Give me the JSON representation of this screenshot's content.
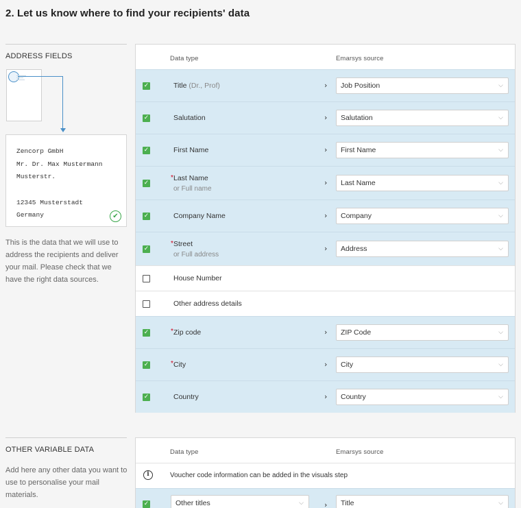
{
  "heading": "2. Let us know where to find your recipients' data",
  "address_section": {
    "label": "ADDRESS FIELDS",
    "card_lines": [
      "Zencorp GmbH",
      "Mr. Dr. Max Mustermann",
      "Musterstr.",
      "",
      "12345 Musterstadt",
      "Germany"
    ],
    "description": "This is the data that we will use to address the recipients and deliver your mail. Please check that we have the right data sources.",
    "col_data_type": "Data type",
    "col_source": "Emarsys source",
    "rows": [
      {
        "label": "Title",
        "hint": "(Dr., Prof)",
        "sub": "",
        "required": false,
        "checked": true,
        "source": "Job Position"
      },
      {
        "label": "Salutation",
        "hint": "",
        "sub": "",
        "required": false,
        "checked": true,
        "source": "Salutation"
      },
      {
        "label": "First Name",
        "hint": "",
        "sub": "",
        "required": false,
        "checked": true,
        "source": "First Name"
      },
      {
        "label": "Last Name",
        "hint": "",
        "sub": "or Full name",
        "required": true,
        "checked": true,
        "source": "Last Name"
      },
      {
        "label": "Company Name",
        "hint": "",
        "sub": "",
        "required": false,
        "checked": true,
        "source": "Company"
      },
      {
        "label": "Street",
        "hint": "",
        "sub": "or Full address",
        "required": true,
        "checked": true,
        "source": "Address"
      },
      {
        "label": "House Number",
        "hint": "",
        "sub": "",
        "required": false,
        "checked": false,
        "source": ""
      },
      {
        "label": "Other address details",
        "hint": "",
        "sub": "",
        "required": false,
        "checked": false,
        "source": ""
      },
      {
        "label": "Zip code",
        "hint": "",
        "sub": "",
        "required": true,
        "checked": true,
        "source": "ZIP Code"
      },
      {
        "label": "City",
        "hint": "",
        "sub": "",
        "required": true,
        "checked": true,
        "source": "City"
      },
      {
        "label": "Country",
        "hint": "",
        "sub": "",
        "required": false,
        "checked": true,
        "source": "Country"
      }
    ]
  },
  "other_section": {
    "label": "OTHER VARIABLE DATA",
    "description": "Add here any other data you want to use to personalise your mail materials.",
    "col_data_type": "Data type",
    "col_source": "Emarsys source",
    "info_text": "Voucher code information can be added in the visuals step",
    "row": {
      "checked": true,
      "type_value": "Other titles",
      "source": "Title"
    }
  },
  "colors": {
    "row_on": "#d8eaf4",
    "check_green": "#4caf50",
    "required_red": "#d0021b",
    "connector_blue": "#4a90c8"
  },
  "icons": {
    "checked": "checkmark-icon",
    "chevron": "chevron-right-icon",
    "caret": "chevron-down-icon",
    "info": "info-icon",
    "verified": "double-check-icon"
  }
}
